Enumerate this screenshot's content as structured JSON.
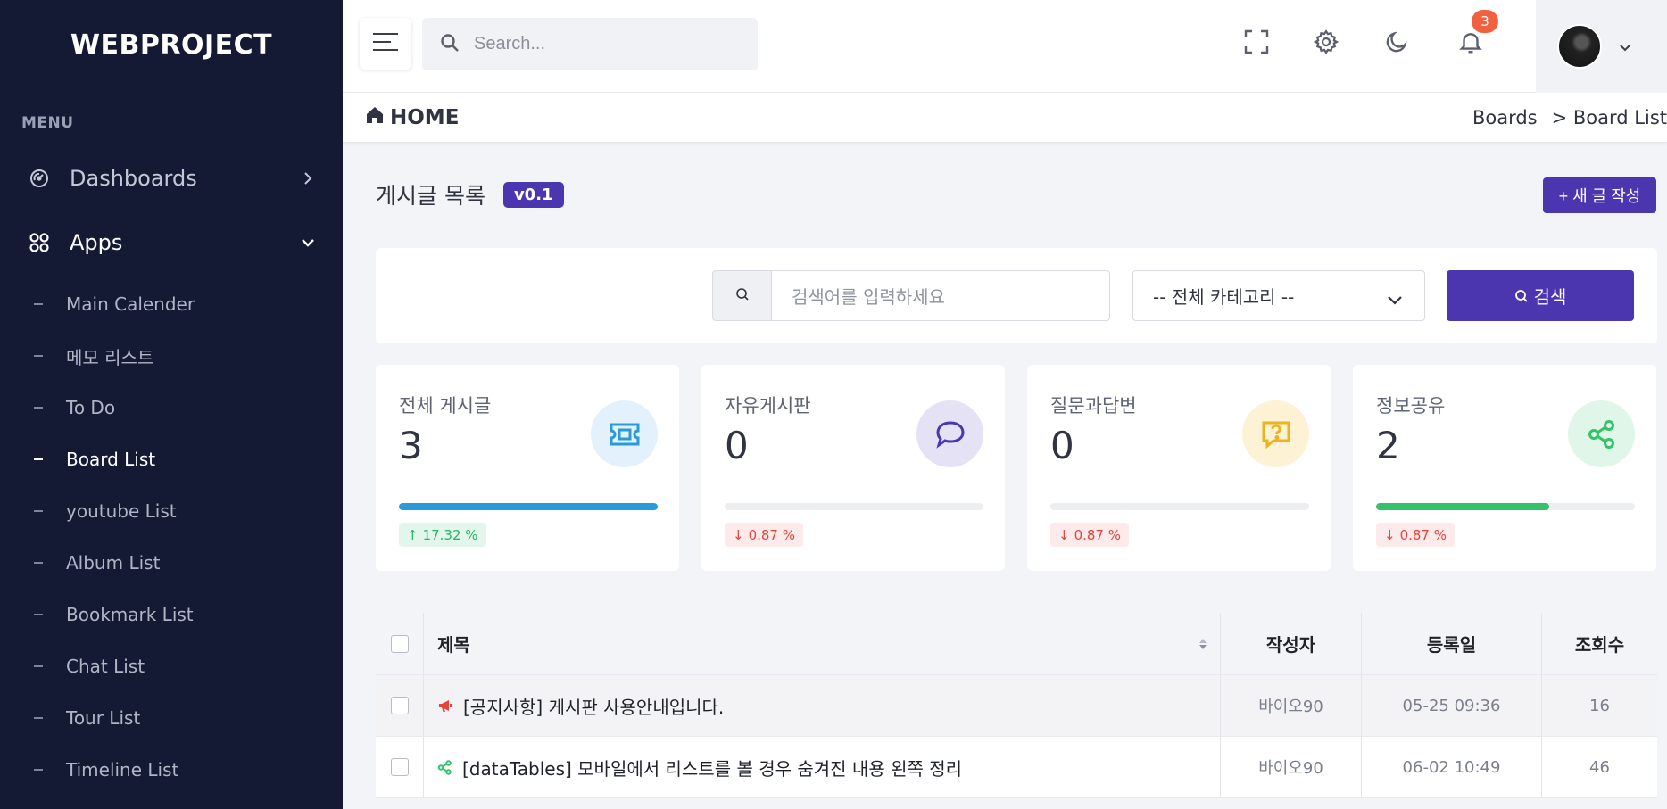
{
  "app": {
    "brand": "WEBPROJECT"
  },
  "sidebar": {
    "menu_title": "MENU",
    "main": [
      {
        "label": "Dashboards",
        "icon": "gauge-icon",
        "expanded": false
      },
      {
        "label": "Apps",
        "icon": "grid-icon",
        "expanded": true
      }
    ],
    "items": [
      {
        "label": "Main Calender"
      },
      {
        "label": "메모 리스트"
      },
      {
        "label": "To Do"
      },
      {
        "label": "Board List",
        "active": true
      },
      {
        "label": "youtube List"
      },
      {
        "label": "Album List"
      },
      {
        "label": "Bookmark List"
      },
      {
        "label": "Chat List"
      },
      {
        "label": "Tour List"
      },
      {
        "label": "Timeline List"
      }
    ]
  },
  "header": {
    "search_placeholder": "Search...",
    "notification_count": "3",
    "icons": [
      "menu-icon",
      "search-icon",
      "fullscreen-icon",
      "gear-icon",
      "moon-icon",
      "bell-icon",
      "chevron-down-icon"
    ]
  },
  "breadcrumb": {
    "home": "HOME",
    "items": [
      "Boards",
      "> Board List"
    ]
  },
  "page": {
    "title": "게시글 목록",
    "version": "v0.1",
    "new_button": "+ 새 글 작성"
  },
  "filter": {
    "placeholder": "검색어를 입력하세요",
    "category": "-- 전체 카테고리 --",
    "search_button": "검색"
  },
  "stats": [
    {
      "label": "전체 게시글",
      "value": "3",
      "progress": 1.0,
      "change": "17.32 %",
      "direction": "up",
      "icon": "ticket-icon",
      "color": "#2a9bd8",
      "bg": "#e2f1fb"
    },
    {
      "label": "자유게시판",
      "value": "0",
      "progress": 0,
      "change": "0.87 %",
      "direction": "down",
      "icon": "chat-bubble-icon",
      "color": "#4b36b0",
      "bg": "#e6e2f6"
    },
    {
      "label": "질문과답변",
      "value": "0",
      "progress": 0,
      "change": "0.87 %",
      "direction": "down",
      "icon": "question-icon",
      "color": "#e9b420",
      "bg": "#fdf2d3"
    },
    {
      "label": "정보공유",
      "value": "2",
      "progress": 0.67,
      "change": "0.87 %",
      "direction": "down",
      "icon": "share-icon",
      "color": "#34c36b",
      "bg": "#e0f6e8"
    }
  ],
  "table": {
    "headers": {
      "title": "제목",
      "author": "작성자",
      "date": "등록일",
      "views": "조회수"
    },
    "rows": [
      {
        "title": "[공지사항] 게시판 사용안내입니다.",
        "author": "바이오90",
        "date": "05-25 09:36",
        "views": "16",
        "icon": "megaphone-icon"
      },
      {
        "title": "[dataTables] 모바일에서 리스트를 볼 경우 숨겨진 내용 왼쪽 정리",
        "author": "바이오90",
        "date": "06-02 10:49",
        "views": "46",
        "icon": "share-icon"
      }
    ]
  }
}
